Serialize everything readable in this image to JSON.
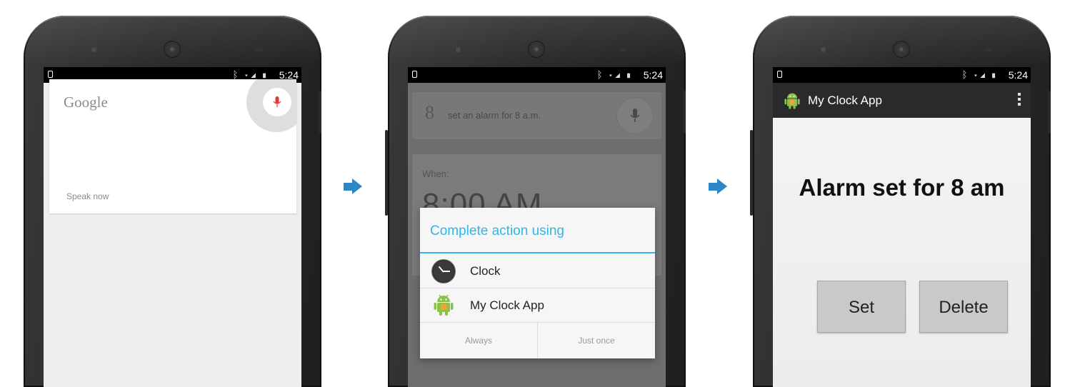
{
  "status_bar": {
    "time": "5:24",
    "icons": "ᛒ ▾◢ ▮"
  },
  "screen1": {
    "logo": "Google",
    "prompt": "Speak now"
  },
  "screen2": {
    "search_g": "8",
    "query": "set an alarm for 8 a.m.",
    "when_label": "When:",
    "when_time": "8:00 AM",
    "dialog": {
      "title": "Complete action using",
      "items": [
        {
          "label": "Clock",
          "icon": "clock-icon"
        },
        {
          "label": "My Clock App",
          "icon": "android-icon"
        }
      ],
      "buttons": [
        "Always",
        "Just once"
      ]
    }
  },
  "screen3": {
    "app_title": "My Clock App",
    "heading": "Alarm set for 8 am",
    "buttons": [
      "Set",
      "Delete"
    ]
  },
  "colors": {
    "accent": "#33b5e5",
    "arrow": "#2b87c6",
    "mic_red": "#e53935",
    "android_green": "#8bc34a"
  }
}
